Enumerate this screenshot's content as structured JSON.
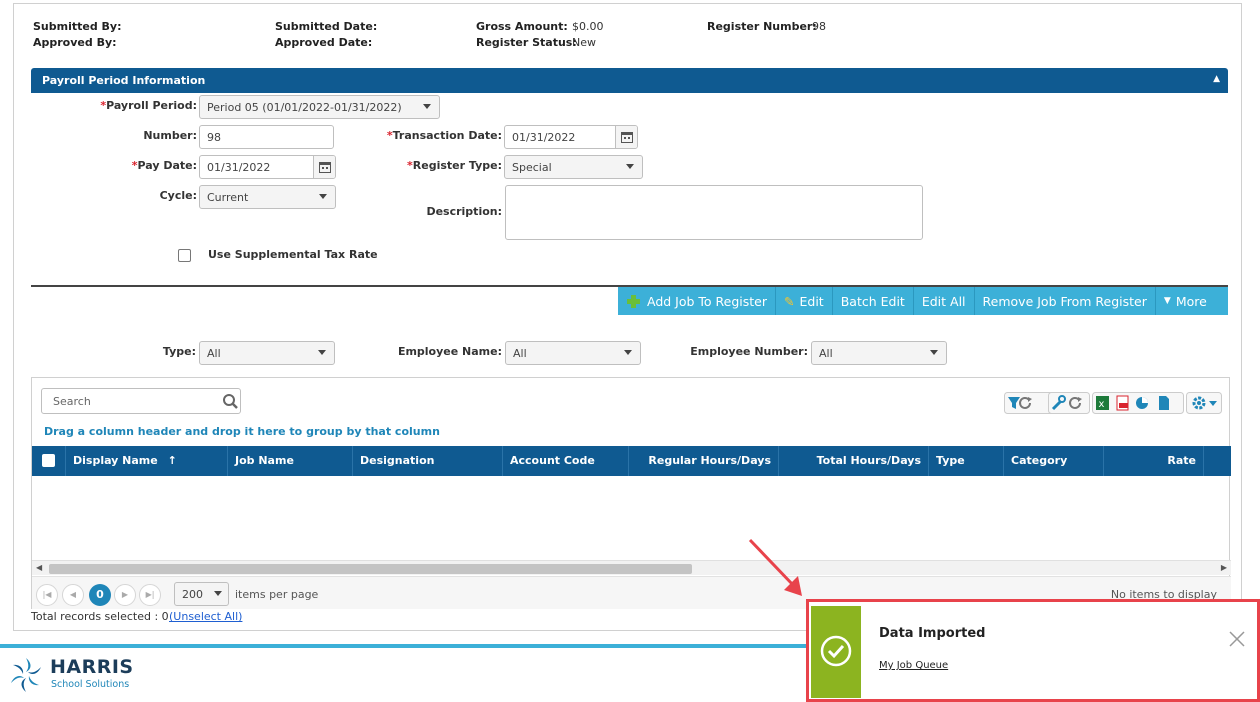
{
  "header": {
    "submitted_by_label": "Submitted By:",
    "approved_by_label": "Approved By:",
    "submitted_date_label": "Submitted Date:",
    "approved_date_label": "Approved Date:",
    "gross_amount_label": "Gross Amount:",
    "gross_amount_value": "$0.00",
    "register_status_label": "Register Status:",
    "register_status_value": "New",
    "register_number_label": "Register Number:",
    "register_number_value": "98"
  },
  "section": {
    "title": "Payroll Period Information"
  },
  "form": {
    "payroll_period_label": "Payroll Period:",
    "payroll_period_value": "Period 05 (01/01/2022-01/31/2022)",
    "number_label": "Number:",
    "number_value": "98",
    "pay_date_label": "Pay Date:",
    "pay_date_value": "01/31/2022",
    "cycle_label": "Cycle:",
    "cycle_value": "Current",
    "transaction_date_label": "Transaction Date:",
    "transaction_date_value": "01/31/2022",
    "register_type_label": "Register Type:",
    "register_type_value": "Special",
    "description_label": "Description:",
    "description_value": "",
    "supplemental_label": "Use Supplemental Tax Rate",
    "required_mark": "*"
  },
  "toolbar": {
    "add_job": "Add Job To Register",
    "edit": "Edit",
    "batch_edit": "Batch Edit",
    "edit_all": "Edit All",
    "remove_job": "Remove Job From Register",
    "more": "More"
  },
  "filters": {
    "type_label": "Type:",
    "type_value": "All",
    "employee_name_label": "Employee Name:",
    "employee_name_value": "All",
    "employee_number_label": "Employee Number:",
    "employee_number_value": "All"
  },
  "grid": {
    "search_placeholder": "Search",
    "group_hint": "Drag a column header and drop it here to group by that column",
    "columns": [
      "Display Name",
      "Job Name",
      "Designation",
      "Account Code",
      "Regular Hours/Days",
      "Total Hours/Days",
      "Type",
      "Category",
      "Rate"
    ],
    "sort_indicator": "↑",
    "current_page": "0",
    "page_size": "200",
    "items_per_page": "items per page",
    "no_items": "No items to display",
    "total_selected": "Total records selected : 0",
    "unselect_all": "(Unselect All)"
  },
  "footer": {
    "brand_name": "HARRIS",
    "brand_sub": "School Solutions"
  },
  "toast": {
    "title": "Data Imported",
    "link": "My Job Queue"
  },
  "colors": {
    "header_blue": "#0f5a91",
    "toolbar_blue": "#3cb0d8",
    "link_blue": "#1f86b8",
    "toast_green": "#8cb420",
    "highlight_red": "#e8434b"
  }
}
